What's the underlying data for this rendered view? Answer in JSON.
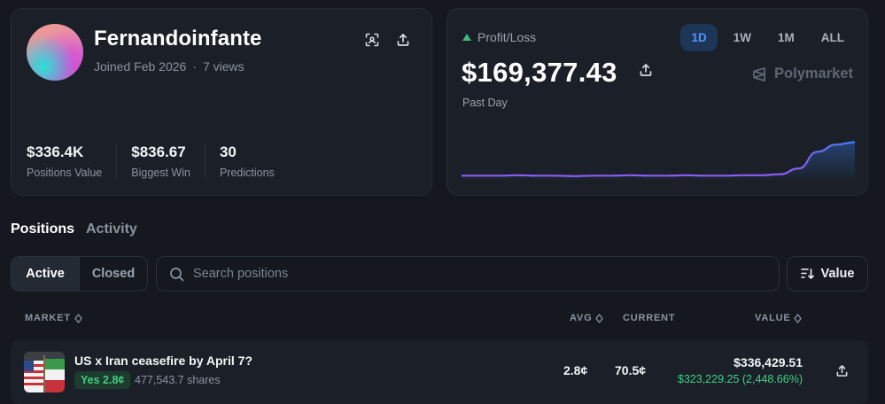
{
  "profile": {
    "username": "Fernandoinfante",
    "joined": "Joined Feb 2026",
    "views": "7 views",
    "stats": [
      {
        "value": "$336.4K",
        "label": "Positions Value"
      },
      {
        "value": "$836.67",
        "label": "Biggest Win"
      },
      {
        "value": "30",
        "label": "Predictions"
      }
    ],
    "icons": [
      "scan-qr-icon",
      "share-icon"
    ]
  },
  "pnl": {
    "label": "Profit/Loss",
    "value": "$169,377.43",
    "period": "Past Day",
    "brand": "Polymarket",
    "ranges": [
      "1D",
      "1W",
      "1M",
      "ALL"
    ],
    "active_range": "1D",
    "up_color": "#3fb97a",
    "line_color": "#8b5cf6",
    "line_end_color": "#3b82f6"
  },
  "chart_data": {
    "type": "line",
    "series": [
      {
        "values": [
          0.05,
          0.05,
          0.05,
          0.06,
          0.05,
          0.05,
          0.04,
          0.05,
          0.05,
          0.06,
          0.05,
          0.05,
          0.06,
          0.05,
          0.05,
          0.06,
          0.06,
          0.08,
          0.2,
          0.55,
          0.7,
          0.75
        ]
      }
    ]
  },
  "tabs": {
    "positions": "Positions",
    "activity": "Activity"
  },
  "filters": {
    "active": "Active",
    "closed": "Closed",
    "search_placeholder": "Search positions",
    "sort_label": "Value"
  },
  "table": {
    "headers": {
      "market": "MARKET",
      "avg": "AVG",
      "current": "CURRENT",
      "value": "VALUE"
    },
    "rows": [
      {
        "title": "US x Iran ceasefire by April 7?",
        "outcome": "Yes 2.8¢",
        "shares": "477,543.7 shares",
        "avg": "2.8¢",
        "current": "70.5¢",
        "value": "$336,429.51",
        "pnl": "$323,229.25 (2,448.66%)"
      }
    ]
  }
}
